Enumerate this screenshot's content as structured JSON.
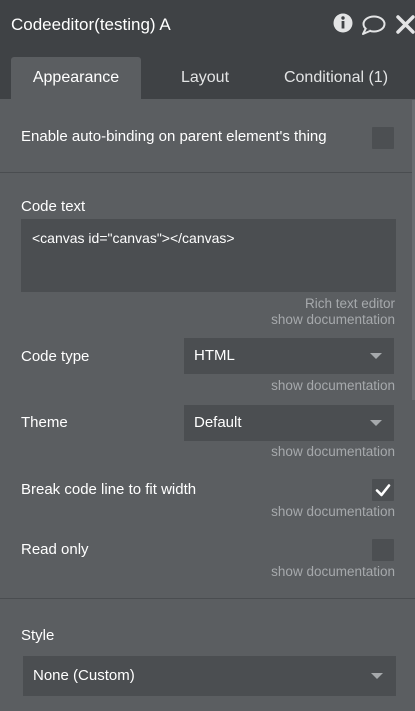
{
  "titlebar": {
    "title": "Codeeditor(testing) A",
    "icons": [
      "info-icon",
      "comment-icon",
      "close-icon"
    ]
  },
  "tabs": [
    {
      "label": "Appearance",
      "active": true
    },
    {
      "label": "Layout",
      "active": false
    },
    {
      "label": "Conditional (1)",
      "active": false
    }
  ],
  "autobinding": {
    "label": "Enable auto-binding on parent element's thing",
    "checked": false
  },
  "code_text": {
    "label": "Code text",
    "value": "<canvas id=\"canvas\"></canvas>",
    "rich_text_link": "Rich text editor",
    "doc_link": "show documentation"
  },
  "code_type": {
    "label": "Code type",
    "value": "HTML",
    "doc_link": "show documentation"
  },
  "theme": {
    "label": "Theme",
    "value": "Default",
    "doc_link": "show documentation"
  },
  "break_line": {
    "label": "Break code line to fit width",
    "checked": true,
    "doc_link": "show documentation"
  },
  "read_only": {
    "label": "Read only",
    "checked": false,
    "doc_link": "show documentation"
  },
  "style": {
    "label": "Style",
    "value": "None (Custom)"
  },
  "colors": {
    "panel_bg": "#5b5e61",
    "header_bg": "#3f4245",
    "field_bg": "#4b4e51",
    "muted_text": "#a6a9ac"
  }
}
